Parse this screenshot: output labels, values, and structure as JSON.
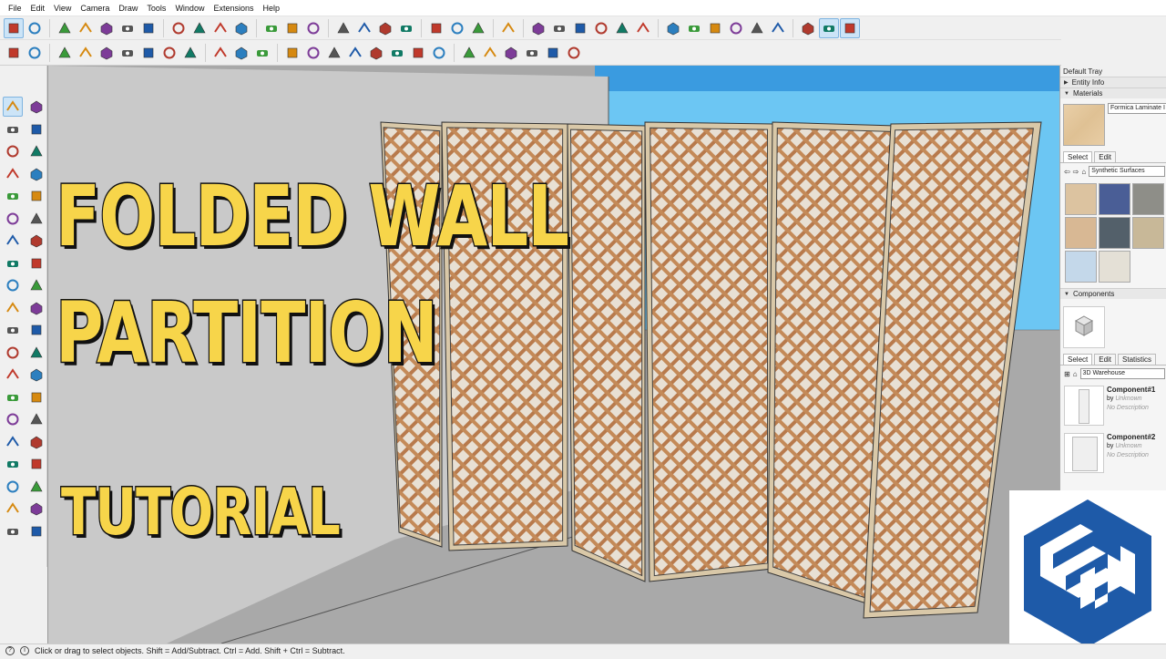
{
  "menu": [
    "File",
    "Edit",
    "View",
    "Camera",
    "Draw",
    "Tools",
    "Window",
    "Extensions",
    "Help"
  ],
  "overlay": {
    "line1": "FOLDED WALL",
    "line2": "PARTITION",
    "line3": "TUTORIAL"
  },
  "tray": {
    "title": "Default Tray",
    "entity_info": "Entity Info",
    "materials": {
      "header": "Materials",
      "current_name": "Formica Laminate I",
      "tabs": [
        "Select",
        "Edit"
      ],
      "library": "Synthetic Surfaces",
      "swatch_colors": [
        "#dcc3a0",
        "#4a5e96",
        "#8e8e88",
        "#d8b894",
        "#53606a",
        "#c8b898",
        "#c4d8ea",
        "#e4e0d6"
      ]
    },
    "components": {
      "header": "Components",
      "tabs": [
        "Select",
        "Edit",
        "Statistics"
      ],
      "library": "3D Warehouse",
      "items": [
        {
          "name": "Component#1",
          "by": "by",
          "author": "Unknown",
          "desc": "No Description"
        },
        {
          "name": "Component#2",
          "by": "by",
          "author": "Unknown",
          "desc": "No Description"
        }
      ]
    }
  },
  "status": {
    "text": "Click or drag to select objects. Shift = Add/Subtract. Ctrl = Add. Shift + Ctrl = Subtract."
  },
  "colors": {
    "title_fill": "#f7d54a",
    "title_outline": "#111111",
    "sky": "#6cc6f3",
    "ground": "#a9a9a9",
    "wall": "#c9c9c9",
    "frame_wood": "#d9c8a8",
    "lattice": "#b87a4c",
    "sketchup_blue": "#1e5aa8"
  },
  "icons": {
    "toolbar1": [
      "select-icon",
      "eraser-icon",
      "line-icon",
      "arc-icon",
      "shape-icon",
      "push-pull-icon",
      "move-icon",
      "rotate-icon",
      "scale-icon",
      "offset-icon",
      "tape-icon",
      "text-icon",
      "dimension-icon",
      "paint-icon",
      "orbit-icon",
      "pan-icon",
      "zoom-icon",
      "zoom-extents-icon",
      "sandbox-icon",
      "warehouse-icon",
      "extension-icon",
      "user-icon",
      "iso-view-icon",
      "top-view-icon",
      "front-view-icon",
      "right-view-icon",
      "back-view-icon",
      "left-view-icon",
      "xray-icon",
      "wireframe-icon",
      "hidden-line-icon",
      "shaded-icon",
      "textured-icon",
      "monochrome-icon",
      "section-plane-icon",
      "display-section-icon",
      "section-fill-icon"
    ],
    "toolbar2": [
      "color-icon",
      "axes-icon",
      "smoove-icon",
      "stamp-icon",
      "drape-icon",
      "add-detail-icon",
      "flip-edge-icon",
      "from-contours-icon",
      "from-scratch-icon",
      "eye-icon",
      "solid-icon",
      "refresh-icon",
      "split-icon",
      "add-location-icon",
      "tree-icon",
      "terrain-icon",
      "checker-icon",
      "cloud-icon",
      "mail-icon",
      "info-icon",
      "outer-shell-icon",
      "intersect-icon",
      "union-icon",
      "subtract-icon",
      "trim-icon",
      "split-solid-icon"
    ]
  }
}
